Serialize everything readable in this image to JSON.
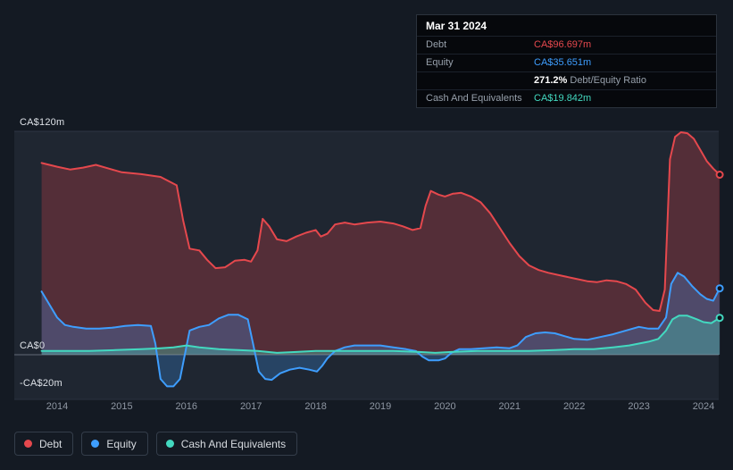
{
  "colors": {
    "debt": "#e5484d",
    "equity": "#3e9eff",
    "cash": "#43d9c0",
    "page_bg": "#141a23",
    "plot_bg": "#1f2631",
    "tooltip_bg": "#06080c",
    "axis_text": "#8f97a3"
  },
  "tooltip": {
    "date": "Mar 31 2024",
    "debt_label": "Debt",
    "debt_value": "CA$96.697m",
    "equity_label": "Equity",
    "equity_value": "CA$35.651m",
    "ratio_value": "271.2%",
    "ratio_label": "Debt/Equity Ratio",
    "cash_label": "Cash And Equivalents",
    "cash_value": "CA$19.842m"
  },
  "chart_data": {
    "type": "area",
    "y_unit": "CA$ millions",
    "x_unit": "year",
    "xlim": [
      2013.75,
      2024.3
    ],
    "ylim": [
      -24,
      120
    ],
    "grid": "horizontal",
    "legend_position": "bottom-left",
    "x_ticks": [
      2014,
      2015,
      2016,
      2017,
      2018,
      2019,
      2020,
      2021,
      2022,
      2023,
      2024
    ],
    "y_ticks": [
      {
        "label": "CA$120m",
        "value": 120
      },
      {
        "label": "CA$0",
        "value": 0
      },
      {
        "label": "-CA$20m",
        "value": -20
      }
    ],
    "series": [
      {
        "name": "Debt",
        "color_key": "debt",
        "points": [
          [
            2013.76,
            103
          ],
          [
            2014.0,
            101
          ],
          [
            2014.2,
            99.5
          ],
          [
            2014.4,
            100.5
          ],
          [
            2014.6,
            102
          ],
          [
            2014.8,
            100
          ],
          [
            2015.0,
            98
          ],
          [
            2015.3,
            97
          ],
          [
            2015.6,
            95.5
          ],
          [
            2015.85,
            91
          ],
          [
            2015.95,
            72
          ],
          [
            2016.05,
            57
          ],
          [
            2016.2,
            56
          ],
          [
            2016.32,
            51
          ],
          [
            2016.45,
            46.5
          ],
          [
            2016.6,
            47
          ],
          [
            2016.75,
            50.5
          ],
          [
            2016.9,
            51
          ],
          [
            2017.0,
            50
          ],
          [
            2017.1,
            56
          ],
          [
            2017.18,
            73
          ],
          [
            2017.28,
            69
          ],
          [
            2017.4,
            62
          ],
          [
            2017.55,
            61
          ],
          [
            2017.7,
            63.5
          ],
          [
            2017.85,
            65.5
          ],
          [
            2018.0,
            67
          ],
          [
            2018.08,
            63.5
          ],
          [
            2018.18,
            65
          ],
          [
            2018.3,
            70
          ],
          [
            2018.45,
            71
          ],
          [
            2018.6,
            70
          ],
          [
            2018.8,
            71
          ],
          [
            2019.0,
            71.5
          ],
          [
            2019.2,
            70.5
          ],
          [
            2019.35,
            69
          ],
          [
            2019.5,
            67
          ],
          [
            2019.62,
            68
          ],
          [
            2019.7,
            80
          ],
          [
            2019.78,
            88
          ],
          [
            2019.9,
            86
          ],
          [
            2020.0,
            85
          ],
          [
            2020.12,
            86.5
          ],
          [
            2020.25,
            87
          ],
          [
            2020.4,
            85
          ],
          [
            2020.55,
            82
          ],
          [
            2020.7,
            76
          ],
          [
            2020.85,
            68
          ],
          [
            2021.0,
            60
          ],
          [
            2021.15,
            53
          ],
          [
            2021.3,
            48
          ],
          [
            2021.45,
            45.5
          ],
          [
            2021.6,
            44
          ],
          [
            2021.8,
            42.5
          ],
          [
            2022.0,
            41
          ],
          [
            2022.2,
            39.5
          ],
          [
            2022.35,
            39
          ],
          [
            2022.5,
            40
          ],
          [
            2022.65,
            39.5
          ],
          [
            2022.8,
            38
          ],
          [
            2022.95,
            35
          ],
          [
            2023.1,
            28
          ],
          [
            2023.22,
            24
          ],
          [
            2023.32,
            23.5
          ],
          [
            2023.4,
            35
          ],
          [
            2023.48,
            105
          ],
          [
            2023.56,
            117
          ],
          [
            2023.65,
            119.5
          ],
          [
            2023.75,
            119
          ],
          [
            2023.85,
            116
          ],
          [
            2023.95,
            110
          ],
          [
            2024.05,
            104
          ],
          [
            2024.15,
            100
          ],
          [
            2024.25,
            96.697
          ]
        ]
      },
      {
        "name": "Equity",
        "color_key": "equity",
        "points": [
          [
            2013.76,
            34
          ],
          [
            2013.88,
            27
          ],
          [
            2014.0,
            20
          ],
          [
            2014.12,
            16
          ],
          [
            2014.25,
            15
          ],
          [
            2014.45,
            14
          ],
          [
            2014.65,
            14
          ],
          [
            2014.85,
            14.5
          ],
          [
            2015.05,
            15.5
          ],
          [
            2015.25,
            16
          ],
          [
            2015.45,
            15.5
          ],
          [
            2015.52,
            6
          ],
          [
            2015.6,
            -13
          ],
          [
            2015.7,
            -17
          ],
          [
            2015.8,
            -17
          ],
          [
            2015.9,
            -13
          ],
          [
            2015.97,
            -1
          ],
          [
            2016.05,
            13
          ],
          [
            2016.2,
            15
          ],
          [
            2016.35,
            16
          ],
          [
            2016.5,
            19.5
          ],
          [
            2016.65,
            21.5
          ],
          [
            2016.8,
            21.5
          ],
          [
            2016.95,
            19
          ],
          [
            2017.03,
            6
          ],
          [
            2017.12,
            -9
          ],
          [
            2017.22,
            -13
          ],
          [
            2017.32,
            -13.5
          ],
          [
            2017.45,
            -10
          ],
          [
            2017.6,
            -8
          ],
          [
            2017.75,
            -7
          ],
          [
            2017.9,
            -8
          ],
          [
            2018.02,
            -9
          ],
          [
            2018.1,
            -6
          ],
          [
            2018.18,
            -2
          ],
          [
            2018.3,
            2
          ],
          [
            2018.45,
            4
          ],
          [
            2018.6,
            5
          ],
          [
            2018.8,
            5
          ],
          [
            2019.0,
            5
          ],
          [
            2019.2,
            4
          ],
          [
            2019.4,
            3
          ],
          [
            2019.55,
            2
          ],
          [
            2019.65,
            -1
          ],
          [
            2019.75,
            -3
          ],
          [
            2019.9,
            -3
          ],
          [
            2020.0,
            -2
          ],
          [
            2020.1,
            1
          ],
          [
            2020.22,
            3
          ],
          [
            2020.4,
            3
          ],
          [
            2020.6,
            3.5
          ],
          [
            2020.8,
            4
          ],
          [
            2021.0,
            3.5
          ],
          [
            2021.12,
            5
          ],
          [
            2021.25,
            9.5
          ],
          [
            2021.4,
            11.5
          ],
          [
            2021.55,
            12
          ],
          [
            2021.7,
            11.5
          ],
          [
            2021.85,
            10
          ],
          [
            2022.0,
            8.5
          ],
          [
            2022.2,
            8
          ],
          [
            2022.4,
            9.5
          ],
          [
            2022.6,
            11
          ],
          [
            2022.8,
            13
          ],
          [
            2023.0,
            15
          ],
          [
            2023.15,
            14
          ],
          [
            2023.3,
            14
          ],
          [
            2023.42,
            20
          ],
          [
            2023.5,
            38
          ],
          [
            2023.6,
            44
          ],
          [
            2023.7,
            42
          ],
          [
            2023.82,
            37
          ],
          [
            2023.95,
            32.5
          ],
          [
            2024.05,
            30
          ],
          [
            2024.15,
            29
          ],
          [
            2024.25,
            35.651
          ]
        ]
      },
      {
        "name": "Cash And Equivalents",
        "color_key": "cash",
        "points": [
          [
            2013.76,
            2
          ],
          [
            2014.1,
            2
          ],
          [
            2014.5,
            2
          ],
          [
            2014.9,
            2.5
          ],
          [
            2015.3,
            3
          ],
          [
            2015.6,
            3.5
          ],
          [
            2015.8,
            4
          ],
          [
            2016.0,
            5
          ],
          [
            2016.2,
            4
          ],
          [
            2016.5,
            3
          ],
          [
            2016.8,
            2.5
          ],
          [
            2017.1,
            2
          ],
          [
            2017.4,
            1
          ],
          [
            2017.7,
            1.5
          ],
          [
            2018.0,
            2
          ],
          [
            2018.4,
            2
          ],
          [
            2018.8,
            2
          ],
          [
            2019.2,
            2
          ],
          [
            2019.6,
            1.5
          ],
          [
            2019.85,
            1
          ],
          [
            2020.1,
            1.5
          ],
          [
            2020.5,
            2
          ],
          [
            2020.9,
            2
          ],
          [
            2021.3,
            2
          ],
          [
            2021.7,
            2.5
          ],
          [
            2022.0,
            3
          ],
          [
            2022.3,
            3
          ],
          [
            2022.6,
            4
          ],
          [
            2022.85,
            5
          ],
          [
            2023.0,
            6
          ],
          [
            2023.15,
            7
          ],
          [
            2023.3,
            8.5
          ],
          [
            2023.42,
            13
          ],
          [
            2023.52,
            19
          ],
          [
            2023.62,
            21
          ],
          [
            2023.75,
            21
          ],
          [
            2023.9,
            19
          ],
          [
            2024.0,
            17.5
          ],
          [
            2024.12,
            17
          ],
          [
            2024.25,
            19.842
          ]
        ]
      }
    ]
  }
}
